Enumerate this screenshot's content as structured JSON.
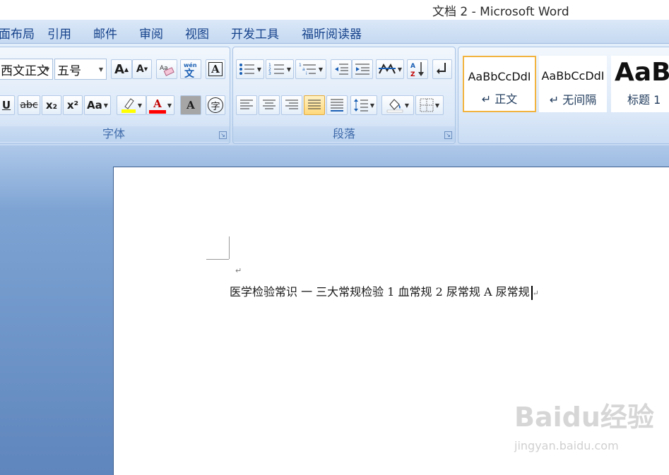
{
  "window": {
    "title": "文档 2 - Microsoft Word"
  },
  "tabs": [
    "面布局",
    "引用",
    "邮件",
    "审阅",
    "视图",
    "开发工具",
    "福昕阅读器"
  ],
  "font_group": {
    "label": "字体",
    "font_name": "西文正文",
    "font_size": "五号",
    "grow_font": "A",
    "shrink_font": "A",
    "clear_format_icon": "clear-format-icon",
    "phonetic_icon": "phonetic-guide-icon",
    "char_border": "A",
    "strike": "abc",
    "subscript": "x₂",
    "superscript": "x²",
    "change_case": "Aa",
    "highlight_color": "#ffff00",
    "font_color": "#ff0000",
    "font_color_label": "A",
    "char_shading": "A",
    "enclose_char": "字"
  },
  "paragraph_group": {
    "label": "段落"
  },
  "styles": [
    {
      "sample": "AaBbCcDdI",
      "name": "↵ 正文",
      "selected": true
    },
    {
      "sample": "AaBbCcDdI",
      "name": "↵ 无间隔",
      "selected": false
    },
    {
      "sample": "AaBl",
      "name": "标题 1",
      "selected": false
    }
  ],
  "document": {
    "empty_mark": "↵",
    "line": "医学检验常识 一 三大常规检验 1 血常规 2 尿常规 A 尿常规",
    "end_mark": "↵"
  },
  "watermark": {
    "logo": "Baidu经验",
    "site": "jingyan.baidu.com"
  }
}
